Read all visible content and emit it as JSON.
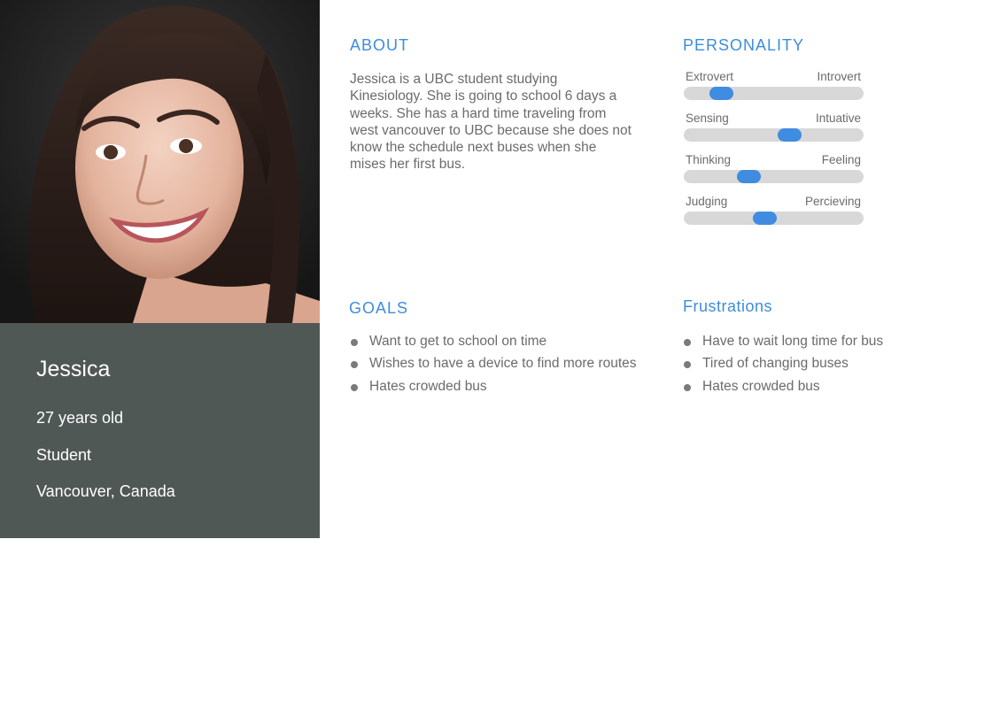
{
  "profile": {
    "name": "Jessica",
    "age": "27 years old",
    "occupation": "Student",
    "location": "Vancouver, Canada"
  },
  "about": {
    "title": "ABOUT",
    "text": "Jessica is a UBC student studying Kinesiology. She is going to school 6 days a weeks. She has a hard time traveling from west vancouver to UBC because she does not know the schedule next buses when she mises her first bus."
  },
  "personality": {
    "title": "PERSONALITY",
    "traits": [
      {
        "left": "Extrovert",
        "right": "Introvert",
        "value": 0.21
      },
      {
        "left": "Sensing",
        "right": "Intuative",
        "value": 0.59
      },
      {
        "left": "Thinking",
        "right": "Feeling",
        "value": 0.36
      },
      {
        "left": "Judging",
        "right": "Percieving",
        "value": 0.45
      }
    ],
    "accent_color": "#3f8ce0"
  },
  "goals": {
    "title": "GOALS",
    "items": [
      "Want to get to school on time",
      "Wishes to have a device to find more routes",
      "Hates crowded bus"
    ]
  },
  "frustrations": {
    "title": "Frustrations",
    "items": [
      "Have to wait long time for bus",
      "Tired of changing buses",
      "Hates crowded bus"
    ]
  },
  "colors": {
    "heading": "#3d8ddc",
    "profile_panel": "#505856"
  }
}
